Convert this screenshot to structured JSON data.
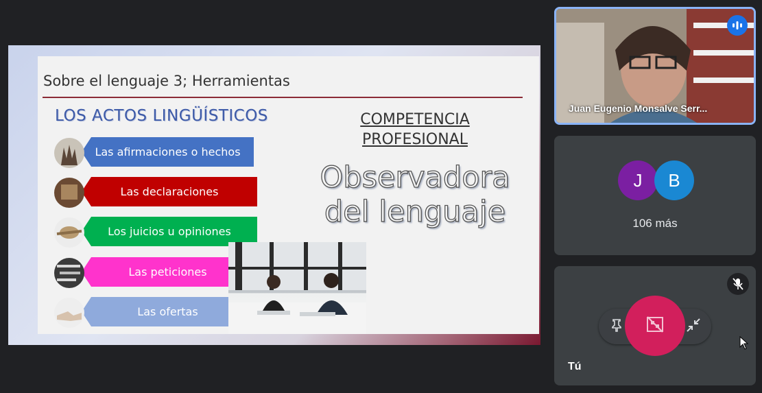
{
  "slide": {
    "title": "Sobre el lenguaje 3; Herramientas",
    "acts_heading": "LOS ACTOS LINGÜÍSTICOS",
    "acts": [
      {
        "label": "Las afirmaciones o hechos",
        "color": "#4472c4"
      },
      {
        "label": "Las declaraciones",
        "color": "#c00000"
      },
      {
        "label": "Los juicios u opiniones",
        "color": "#00b050"
      },
      {
        "label": "Las peticiones",
        "color": "#ff33cc"
      },
      {
        "label": "Las ofertas",
        "color": "#8faadc"
      }
    ],
    "competence_heading": "COMPETENCIA PROFESIONAL",
    "observer_line1": "Observadora",
    "observer_line2": "del lenguaje"
  },
  "participants": {
    "speaker_name": "Juan Eugenio Monsalve Serr...",
    "avatar_j": "J",
    "avatar_b": "B",
    "more_label": "106 más",
    "self_label": "Tú"
  },
  "colors": {
    "avatar_j": "#7b1fa2",
    "avatar_b": "#1a88d3",
    "present_active": "#d21f5c",
    "speaking_border": "#8ab4f8"
  },
  "icons": {
    "speaking": "audio-bars-icon",
    "mic": "mic-off-icon",
    "pin": "pin-icon",
    "present": "stop-presenting-icon",
    "minimize": "minimize-icon",
    "cursor": "mouse-cursor-icon"
  }
}
